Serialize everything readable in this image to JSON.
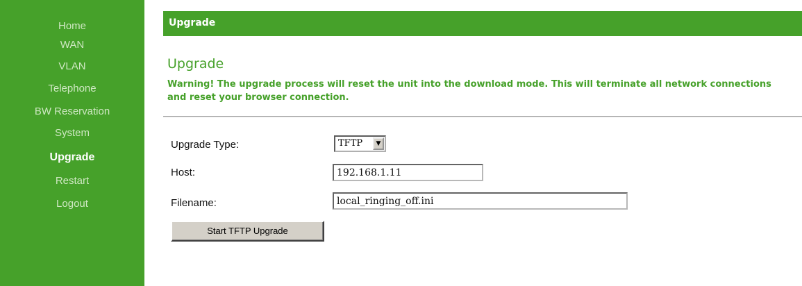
{
  "sidebar": {
    "items": [
      {
        "label": "Home"
      },
      {
        "label": "WAN"
      },
      {
        "label": "VLAN"
      },
      {
        "label": "Telephone"
      },
      {
        "label": "BW Reservation"
      },
      {
        "label": "System"
      },
      {
        "label": "Upgrade"
      },
      {
        "label": "Restart"
      },
      {
        "label": "Logout"
      }
    ],
    "active": "Upgrade"
  },
  "header": {
    "title": "Upgrade"
  },
  "main": {
    "title": "Upgrade",
    "warning": "Warning! The upgrade process will reset the unit into the download mode. This will terminate all network connections and reset your browser connection."
  },
  "form": {
    "upgrade_type_label": "Upgrade Type:",
    "upgrade_type_value": "TFTP",
    "host_label": "Host:",
    "host_value": "192.168.1.11",
    "filename_label": "Filename:",
    "filename_value": "local_ringing_off.ini",
    "start_button": "Start TFTP Upgrade"
  },
  "colors": {
    "brand_green": "#46a12a",
    "sidebar_text": "#cfe8c3"
  }
}
